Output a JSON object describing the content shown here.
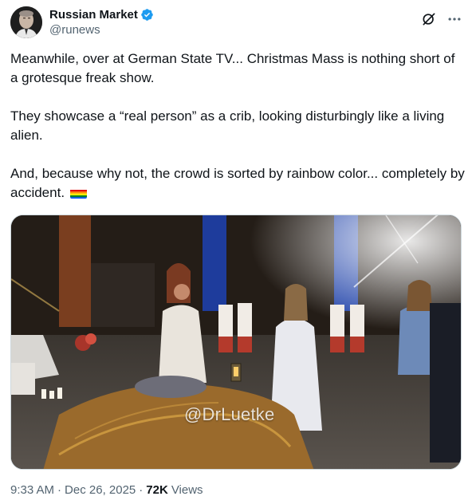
{
  "author": {
    "display_name": "Russian Market",
    "handle": "@runews",
    "verified": true,
    "verified_color": "#1d9bf0"
  },
  "icons": {
    "avatar": "avatar",
    "verified": "verified-badge-icon",
    "grok": "grok-icon",
    "more": "more-icon",
    "flag": "rainbow-flag-icon"
  },
  "tweet": {
    "paragraphs": [
      "Meanwhile, over at German State TV... Christmas Mass is nothing short of a grotesque freak show.",
      "They showcase a “real person” as a crib, looking disturbingly like a living alien.",
      "And, because why not, the crowd is sorted by rainbow color... completely by accident."
    ]
  },
  "media": {
    "watermark": "@DrLuetke"
  },
  "meta": {
    "time": "9:33 AM",
    "separator": "·",
    "date": "Dec 26, 2025",
    "views_count": "72K",
    "views_label": "Views"
  },
  "colors": {
    "text": "#0f1419",
    "secondary": "#536471",
    "border": "#cfd9de"
  }
}
